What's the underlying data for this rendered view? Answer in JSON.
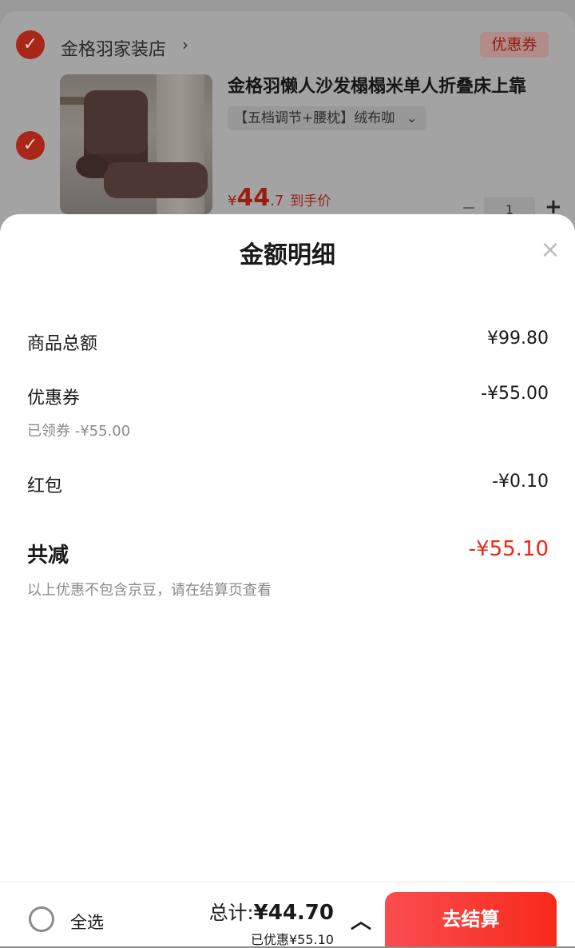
{
  "cart": {
    "shop_name": "金格羽家装店",
    "shop_arrow": "›",
    "coupon_tag": "优惠券",
    "product_title": "金格羽懒人沙发榻榻米单人折叠床上靠",
    "sku": "【五档调节+腰枕】绒布咖",
    "sku_arrow": "⌄",
    "price_symbol": "¥",
    "price_int": "44",
    "price_dec": ".7",
    "price_note": "到手价",
    "qty": "1",
    "qty_minus": "−",
    "qty_plus": "+",
    "check_glyph": "✓"
  },
  "sheet": {
    "title": "金额明细",
    "close": "×",
    "rows": [
      {
        "label": "商品总额",
        "value": "¥99.80"
      },
      {
        "label": "优惠券",
        "value": "-¥55.00",
        "note": "已领券 -¥55.00"
      },
      {
        "label": "红包",
        "value": "-¥0.10"
      }
    ],
    "total_label": "共减",
    "total_value": "-¥55.10",
    "total_note": "以上优惠不包含京豆，请在结算页查看"
  },
  "bottom": {
    "select_all": "全选",
    "total_prefix": "总计:",
    "total_amount": "¥44.70",
    "saved": "已优惠¥55.10",
    "chevron": "︿",
    "checkout": "去结算"
  },
  "colors": {
    "accent": "#f0250f",
    "checkout_start": "#fa4d50",
    "checkout_end": "#f72a1a"
  }
}
